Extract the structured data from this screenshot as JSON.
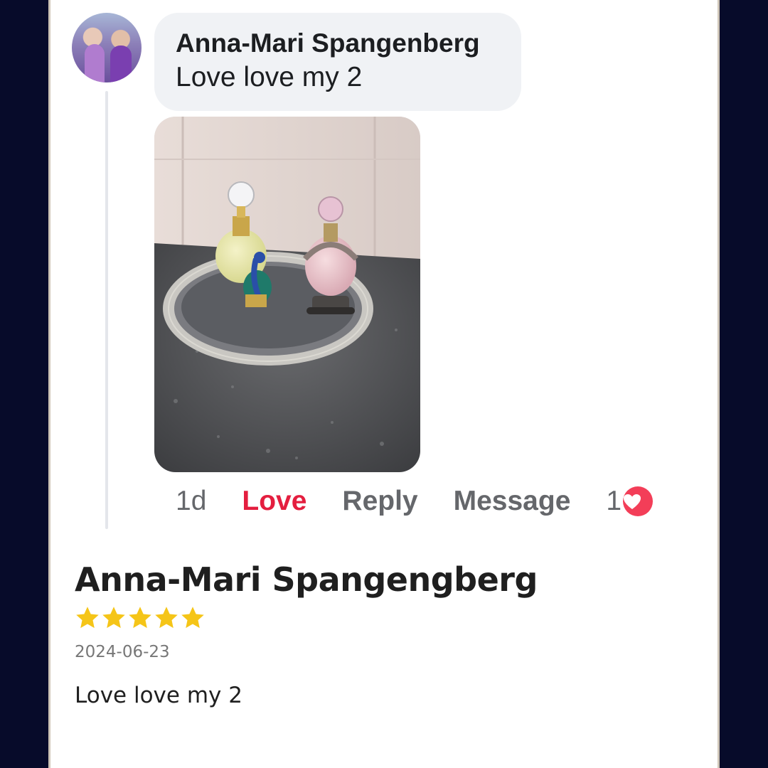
{
  "comment": {
    "author": "Anna-Mari Spangenberg",
    "text": "Love love my 2",
    "photo_alt": "Two decorative perfume bottles on a mirrored tray",
    "actions": {
      "time": "1d",
      "love": "Love",
      "reply": "Reply",
      "message": "Message",
      "reaction_count": "1"
    }
  },
  "review": {
    "author": "Anna-Mari Spangengberg",
    "rating": 5,
    "rating_max": 5,
    "date": "2024-06-23",
    "text": "Love love my 2"
  },
  "colors": {
    "page_background": "#070b2a",
    "love_red": "#e41e3f",
    "reaction_heart": "#f33e58",
    "star_gold": "#f5c518",
    "bubble_gray": "#f0f2f5"
  },
  "icons": {
    "reaction": "heart-icon",
    "rating": "star-icon"
  }
}
